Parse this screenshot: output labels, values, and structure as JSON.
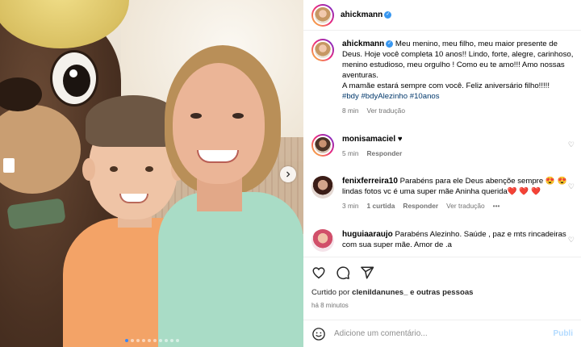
{
  "post": {
    "username": "ahickmann",
    "verified": true
  },
  "caption": {
    "username": "ahickmann",
    "text": "Meu menino, meu filho, meu maior presente de Deus. Hoje você completa 10 anos!! Lindo, forte, alegre, carinhoso, menino estudioso, meu orgulho ! Como eu te amo!!! Amo nossas aventuras.\nA mamãe estará sempre com você. Feliz aniversário filho!!!!!",
    "hashtags": "#bdy #bdyAlezinho #10anos",
    "time": "8 min",
    "translate": "Ver tradução"
  },
  "comments": [
    {
      "username": "monisamaciel",
      "text": "♥",
      "time": "5 min",
      "reply": "Responder"
    },
    {
      "username": "fenixferreira10",
      "text": "Parabéns para ele Deus abençõe sempre 😍 😍 lindas fotos vc é uma super mãe Aninha querida❤️ ❤️ ❤️",
      "time": "3 min",
      "likes": "1 curtida",
      "reply": "Responder",
      "translate": "Ver tradução",
      "more": "•••"
    },
    {
      "username": "huguiaaraujo",
      "text": "Parabéns Alezinho. Saúde , paz e mts rincadeiras com sua super mãe. Amor de .a"
    }
  ],
  "likes": {
    "prefix": "Curtido por",
    "user": "clenildanunes_",
    "suffix": "e outras pessoas"
  },
  "timestamp": "há 8 minutos",
  "add_comment": {
    "placeholder": "Adicione um comentário...",
    "publish": "Publi"
  },
  "carousel": {
    "total": 10,
    "active": 1
  },
  "icons": {
    "like": "heart-icon",
    "comment": "comment-icon",
    "share": "share-icon",
    "emoji": "emoji-icon",
    "next": "chevron-right-icon"
  },
  "colors": {
    "accent": "#0095f6",
    "verified": "#3897f0",
    "hashtag": "#00376b"
  }
}
